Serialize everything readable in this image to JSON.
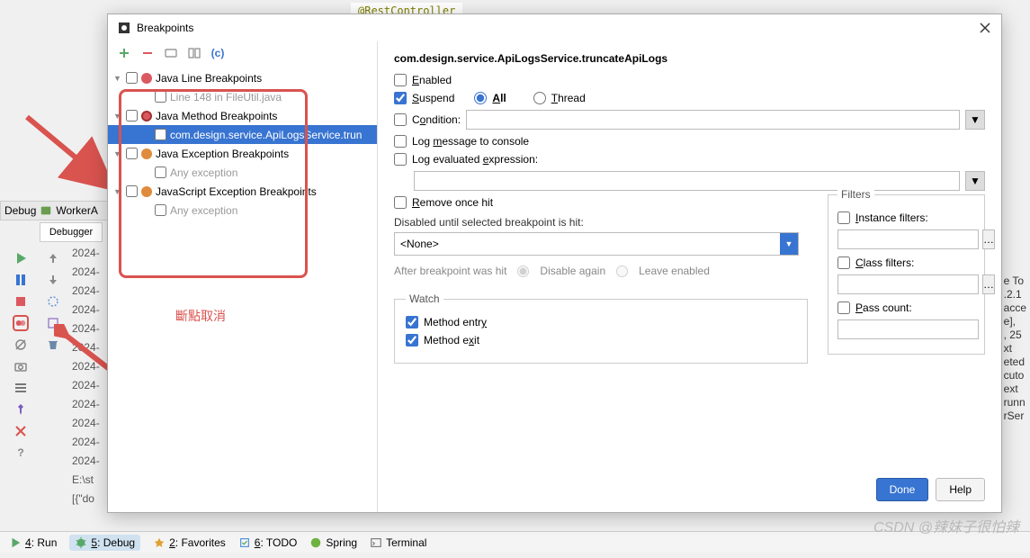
{
  "bg": {
    "code_top": "@RestController",
    "right_lines": [
      "e To",
      ".2.1",
      "acce",
      "e],",
      ", 25",
      "xt",
      "eted",
      "cuto",
      "ext",
      "runn",
      "rSer"
    ]
  },
  "debug_panel": {
    "tab1": "Debug",
    "tab2": "WorkerA",
    "debugger": "Debugger"
  },
  "timestamps": [
    "2024-",
    "2024-",
    "2024-",
    "2024-",
    "2024-",
    "2024-",
    "2024-",
    "2024-",
    "2024-",
    "2024-",
    "2024-",
    "2024-"
  ],
  "log_tail": [
    "E:\\st",
    "[{\"do"
  ],
  "bottom": {
    "run": "4: Run",
    "debug": "5: Debug",
    "fav": "2: Favorites",
    "todo": "6: TODO",
    "spring": "Spring",
    "terminal": "Terminal"
  },
  "dialog": {
    "title": "Breakpoints",
    "tree": {
      "group1": "Java Line Breakpoints",
      "item1": "Line 148 in FileUtil.java",
      "group2": "Java Method Breakpoints",
      "item2": "com.design.service.ApiLogsService.trun",
      "group3": "Java Exception Breakpoints",
      "item3": "Any exception",
      "group4": "JavaScript Exception Breakpoints",
      "item4": "Any exception"
    },
    "annotation": "斷點取消",
    "right": {
      "title": "com.design.service.ApiLogsService.truncateApiLogs",
      "enabled": "Enabled",
      "suspend": "Suspend",
      "all": "All",
      "thread": "Thread",
      "condition": "Condition:",
      "logmsg": "Log message to console",
      "logeval": "Log evaluated expression:",
      "remove": "Remove once hit",
      "disabled_label": "Disabled until selected breakpoint is hit:",
      "none": "<None>",
      "after": "After breakpoint was hit",
      "disable_again": "Disable again",
      "leave_enabled": "Leave enabled",
      "watch": "Watch",
      "method_entry": "Method entry",
      "method_exit": "Method exit",
      "filters": "Filters",
      "instance": "Instance filters:",
      "class": "Class filters:",
      "pass": "Pass count:",
      "done": "Done",
      "help": "Help"
    }
  },
  "watermark": "CSDN @辣妹子很怕辣"
}
